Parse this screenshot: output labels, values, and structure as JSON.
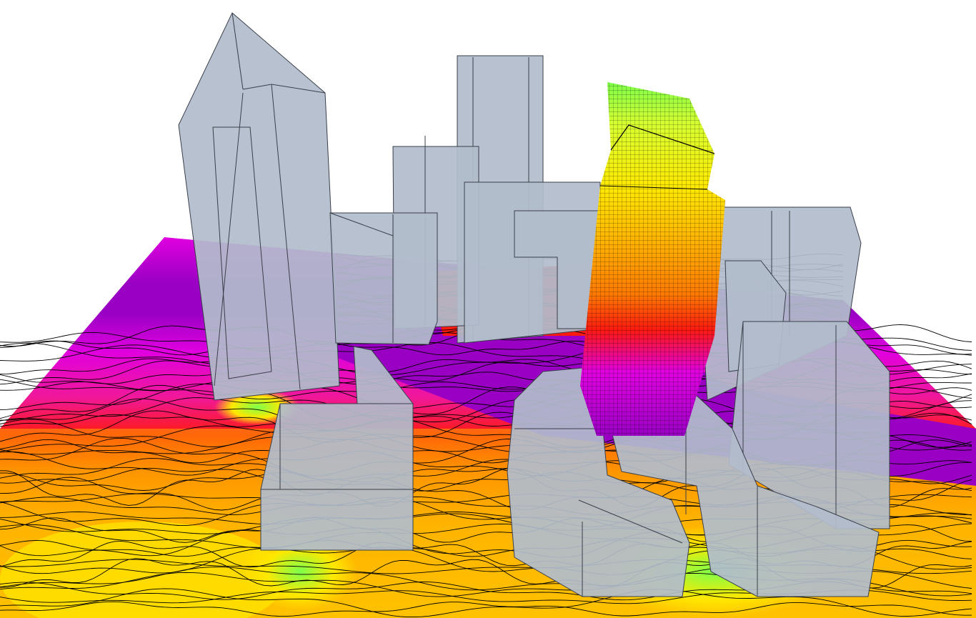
{
  "scene": {
    "description_free": true,
    "colors": {
      "background": "#ffffff",
      "building_fill": "#b2bccb",
      "building_edge": "#3a3f4a",
      "contour_line": "#000000",
      "field_violet": "#9a00c4",
      "field_magenta": "#e000e0",
      "field_pink": "#f0189a",
      "field_red": "#ff1a10",
      "field_orange": "#ff7a00",
      "field_amber": "#ffb300",
      "field_yellow": "#ffe800",
      "field_lime": "#b8ff30",
      "field_green": "#7dff4a"
    }
  }
}
